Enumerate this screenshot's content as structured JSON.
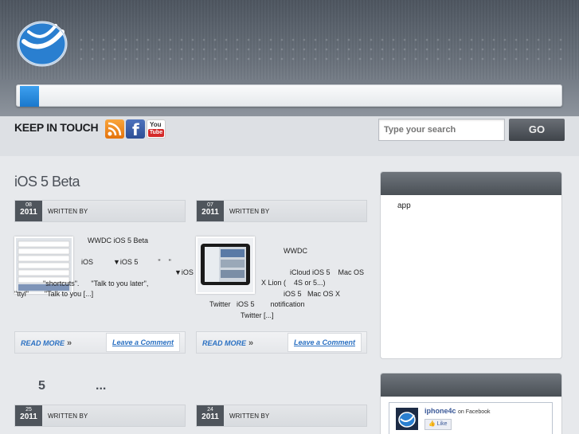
{
  "header": {
    "logo_name": "site-logo"
  },
  "keep_in_touch": {
    "title": "KEEP IN TOUCH",
    "icons": [
      "rss-icon",
      "facebook-icon",
      "youtube-icon"
    ],
    "youtube_top": "You",
    "youtube_bottom": "Tube",
    "facebook_glyph": "f"
  },
  "search": {
    "placeholder": "Type your search",
    "button": "GO"
  },
  "section1": {
    "title": "iOS 5 Beta"
  },
  "section2": {
    "title": "5",
    "suffix": "..."
  },
  "posts": [
    {
      "day": "08",
      "year": "2011",
      "written_by": "WRITTEN BY",
      "lines": [
        "WWDC        iOS 5 Beta",
        "",
        "iOS          ▼iOS 5          \"    \"",
        "                                              ▼iOS",
        "\"shortcuts\".      \"Talk to you later\",",
        "\"ttyl\"        \"Talk to you [...]"
      ],
      "read_more": "READ MORE",
      "comment": "Leave a Comment"
    },
    {
      "day": "07",
      "year": "2011",
      "written_by": "WRITTEN BY",
      "lines": [
        "WWDC",
        "",
        "iCloud iOS 5    Mac OS",
        "X Lion (    4S or 5...)",
        "iOS 5   Mac OS X",
        "Twitter   iOS 5        notification",
        "Twitter [...]"
      ],
      "read_more": "READ MORE",
      "comment": "Leave a Comment"
    },
    {
      "day": "25",
      "year": "2011",
      "written_by": "WRITTEN BY"
    },
    {
      "day": "24",
      "year": "2011",
      "written_by": "WRITTEN BY"
    }
  ],
  "sidebar": {
    "widget1_text": "app",
    "fb_page_name": "iphone4c",
    "fb_on": "on Facebook",
    "fb_like": "Like"
  }
}
